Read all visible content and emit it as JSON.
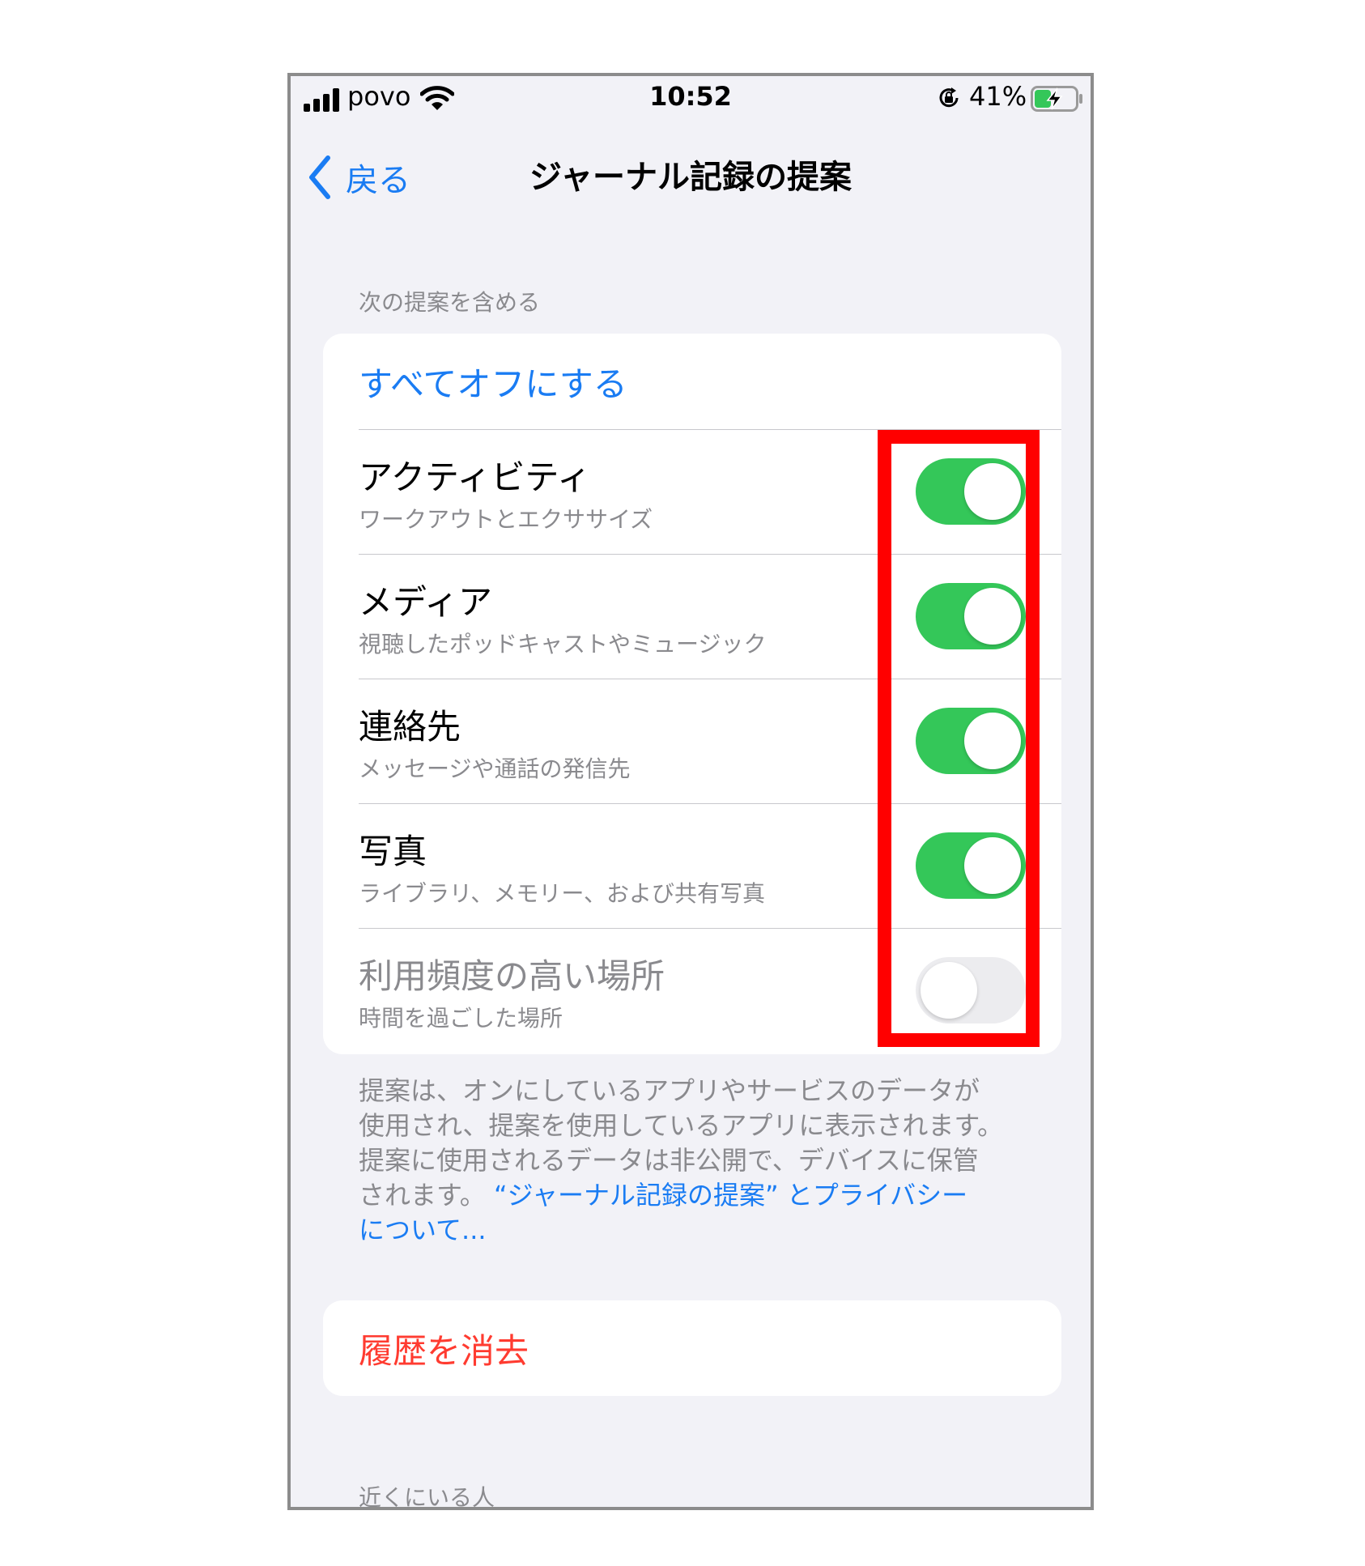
{
  "status_bar": {
    "carrier": "povo",
    "time": "10:52",
    "battery_percent": "41%",
    "battery_level": 0.41
  },
  "nav": {
    "back_label": "戻る",
    "title": "ジャーナル記録の提案"
  },
  "section": {
    "header": "次の提案を含める",
    "turn_all_off": "すべてオフにする",
    "items": [
      {
        "title": "アクティビティ",
        "subtitle": "ワークアウトとエクササイズ",
        "on": true
      },
      {
        "title": "メディア",
        "subtitle": "視聴したポッドキャストやミュージック",
        "on": true
      },
      {
        "title": "連絡先",
        "subtitle": "メッセージや通話の発信先",
        "on": true
      },
      {
        "title": "写真",
        "subtitle": "ライブラリ、メモリー、および共有写真",
        "on": true
      },
      {
        "title": "利用頻度の高い場所",
        "subtitle": "時間を過ごした場所",
        "on": false
      }
    ],
    "footer_lines": [
      "提案は、オンにしているアプリやサービスのデータが",
      "使用され、提案を使用しているアプリに表示されます。",
      "提案に使用されるデータは非公開で、デバイスに保管",
      "されます。"
    ],
    "footer_link_line1": "“ジャーナル記録の提案” とプライバシー",
    "footer_link_line2": "について..."
  },
  "clear_history": "履歴を消去",
  "next_section_header": "近くにいる人",
  "colors": {
    "accent_blue": "#1a7cf3",
    "toggle_green": "#34c759",
    "destructive_red": "#ff3b30",
    "highlight_red": "#ff0000"
  },
  "icons": [
    "signal-icon",
    "wifi-icon",
    "rotation-lock-icon",
    "battery-charging-icon",
    "chevron-left-icon"
  ]
}
